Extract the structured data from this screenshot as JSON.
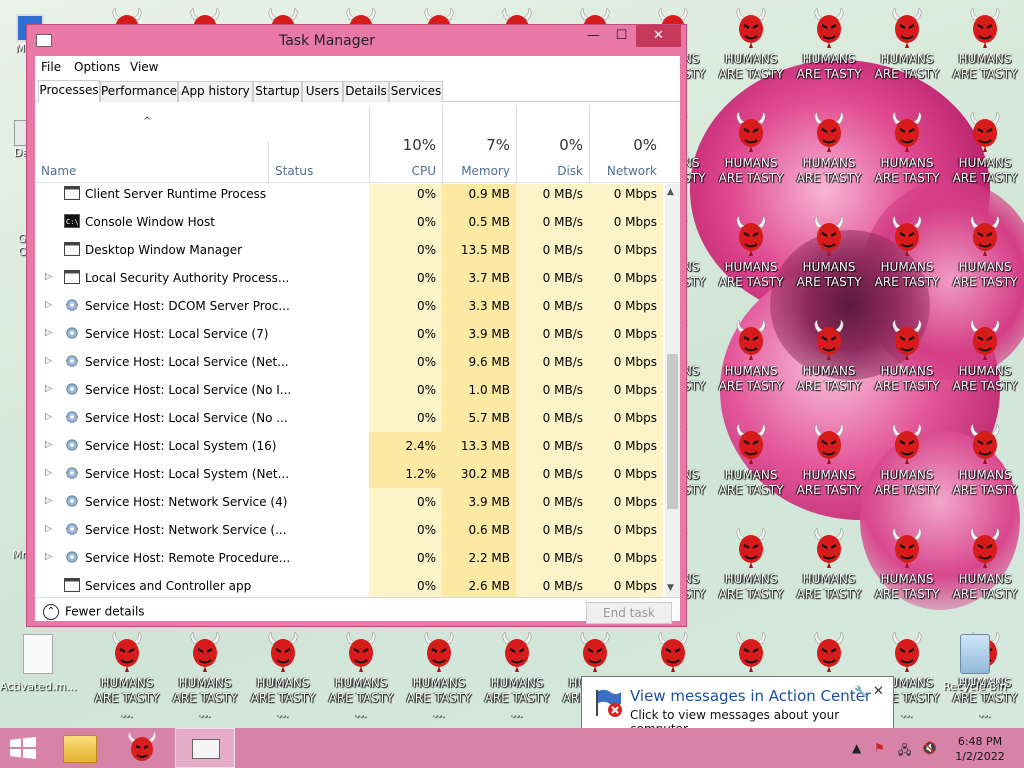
{
  "desktop": {
    "tile_text": "HUMANS ARE TASTY",
    "tile_text_wrapped_line1": "HUMANS",
    "tile_text_wrapped_line2": "ARE TASTY",
    "tile_text_truncated_line2": "ARE TASTY ...",
    "left_icons": [
      "My C",
      "Data",
      "G",
      "C",
      "Mrs"
    ],
    "activated_file_label": "Activated.m...",
    "recycle_bin_label": "Recycle Bin"
  },
  "task_manager": {
    "title": "Task Manager",
    "window_buttons": {
      "minimize": "—",
      "maximize": "☐",
      "close": "✕"
    },
    "menu": [
      "File",
      "Options",
      "View"
    ],
    "tabs": [
      "Processes",
      "Performance",
      "App history",
      "Startup",
      "Users",
      "Details",
      "Services"
    ],
    "active_tab": "Processes",
    "sort_indicator": "^",
    "columns": {
      "name": "Name",
      "status": "Status",
      "cpu": {
        "percent": "10%",
        "label": "CPU"
      },
      "memory": {
        "percent": "7%",
        "label": "Memory"
      },
      "disk": {
        "percent": "0%",
        "label": "Disk"
      },
      "network": {
        "percent": "0%",
        "label": "Network"
      }
    },
    "processes": [
      {
        "name": "Client Server Runtime Process",
        "expandable": false,
        "icon": "window-icon",
        "cpu": "0%",
        "memory": "0.9 MB",
        "disk": "0 MB/s",
        "network": "0 Mbps"
      },
      {
        "name": "Console Window Host",
        "expandable": false,
        "icon": "console-icon",
        "cpu": "0%",
        "memory": "0.5 MB",
        "disk": "0 MB/s",
        "network": "0 Mbps"
      },
      {
        "name": "Desktop Window Manager",
        "expandable": false,
        "icon": "window-icon",
        "cpu": "0%",
        "memory": "13.5 MB",
        "disk": "0 MB/s",
        "network": "0 Mbps"
      },
      {
        "name": "Local Security Authority Process...",
        "expandable": true,
        "icon": "window-icon",
        "cpu": "0%",
        "memory": "3.7 MB",
        "disk": "0 MB/s",
        "network": "0 Mbps"
      },
      {
        "name": "Service Host: DCOM Server Proc...",
        "expandable": true,
        "icon": "gear-icon",
        "cpu": "0%",
        "memory": "3.3 MB",
        "disk": "0 MB/s",
        "network": "0 Mbps"
      },
      {
        "name": "Service Host: Local Service (7)",
        "expandable": true,
        "icon": "gear-icon",
        "cpu": "0%",
        "memory": "3.9 MB",
        "disk": "0 MB/s",
        "network": "0 Mbps"
      },
      {
        "name": "Service Host: Local Service (Net...",
        "expandable": true,
        "icon": "gear-icon",
        "cpu": "0%",
        "memory": "9.6 MB",
        "disk": "0 MB/s",
        "network": "0 Mbps"
      },
      {
        "name": "Service Host: Local Service (No I...",
        "expandable": true,
        "icon": "gear-icon",
        "cpu": "0%",
        "memory": "1.0 MB",
        "disk": "0 MB/s",
        "network": "0 Mbps"
      },
      {
        "name": "Service Host: Local Service (No ...",
        "expandable": true,
        "icon": "gear-icon",
        "cpu": "0%",
        "memory": "5.7 MB",
        "disk": "0 MB/s",
        "network": "0 Mbps"
      },
      {
        "name": "Service Host: Local System (16)",
        "expandable": true,
        "icon": "gear-icon",
        "cpu": "2.4%",
        "memory": "13.3 MB",
        "disk": "0 MB/s",
        "network": "0 Mbps",
        "highlight": true
      },
      {
        "name": "Service Host: Local System (Net...",
        "expandable": true,
        "icon": "gear-icon",
        "cpu": "1.2%",
        "memory": "30.2 MB",
        "disk": "0 MB/s",
        "network": "0 Mbps",
        "highlight": true
      },
      {
        "name": "Service Host: Network Service (4)",
        "expandable": true,
        "icon": "gear-icon",
        "cpu": "0%",
        "memory": "3.9 MB",
        "disk": "0 MB/s",
        "network": "0 Mbps"
      },
      {
        "name": "Service Host: Network Service (...",
        "expandable": true,
        "icon": "gear-icon",
        "cpu": "0%",
        "memory": "0.6 MB",
        "disk": "0 MB/s",
        "network": "0 Mbps"
      },
      {
        "name": "Service Host: Remote Procedure...",
        "expandable": true,
        "icon": "gear-icon",
        "cpu": "0%",
        "memory": "2.2 MB",
        "disk": "0 MB/s",
        "network": "0 Mbps"
      },
      {
        "name": "Services and Controller app",
        "expandable": false,
        "icon": "window-icon",
        "cpu": "0%",
        "memory": "2.6 MB",
        "disk": "0 MB/s",
        "network": "0 Mbps"
      }
    ],
    "fewer_details": "Fewer details",
    "end_task": "End task",
    "colors": {
      "frame": "#e879a6",
      "close": "#c7395a",
      "cell_light": "#fdf3c8",
      "cell_mid": "#fbe9a4",
      "header_text": "#4c6f93"
    }
  },
  "notification": {
    "title": "View messages in Action Center",
    "subtitle": "Click to view messages about your computer."
  },
  "taskbar": {
    "time": "6:48 PM",
    "date": "1/2/2022",
    "color": "#d783a8"
  }
}
